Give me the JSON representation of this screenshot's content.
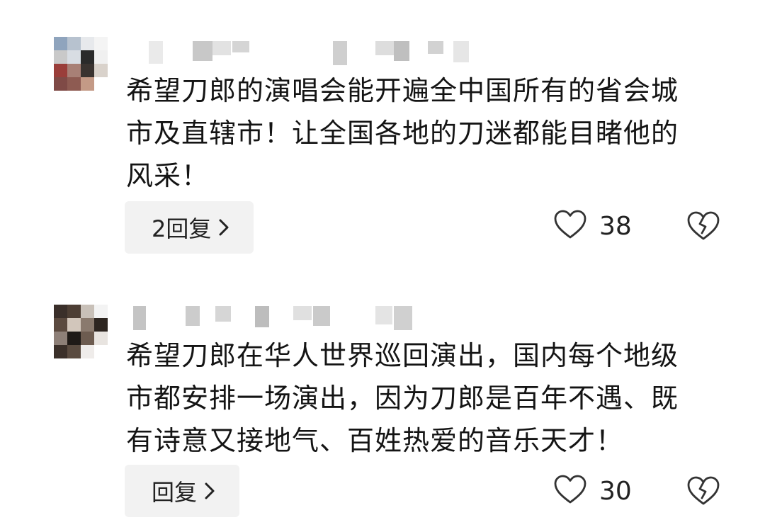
{
  "comments": [
    {
      "text_lines": [
        "希望刀郎的演唱会能开遍全中国所有的省会城",
        "市及直辖市！让全国各地的刀迷都能目睹他的",
        "风采！"
      ],
      "reply_label": "2回复",
      "like_count": "38"
    },
    {
      "text_lines": [
        "希望刀郎在华人世界巡回演出，国内每个地级",
        "市都安排一场演出，因为刀郎是百年不遇、既",
        "有诗意又接地气、百姓热爱的音乐天才！"
      ],
      "reply_label": "回复",
      "like_count": "30"
    }
  ],
  "icons": {
    "like": "heart-outline-icon",
    "dislike": "broken-heart-icon",
    "reply_arrow": "chevron-right-icon"
  }
}
